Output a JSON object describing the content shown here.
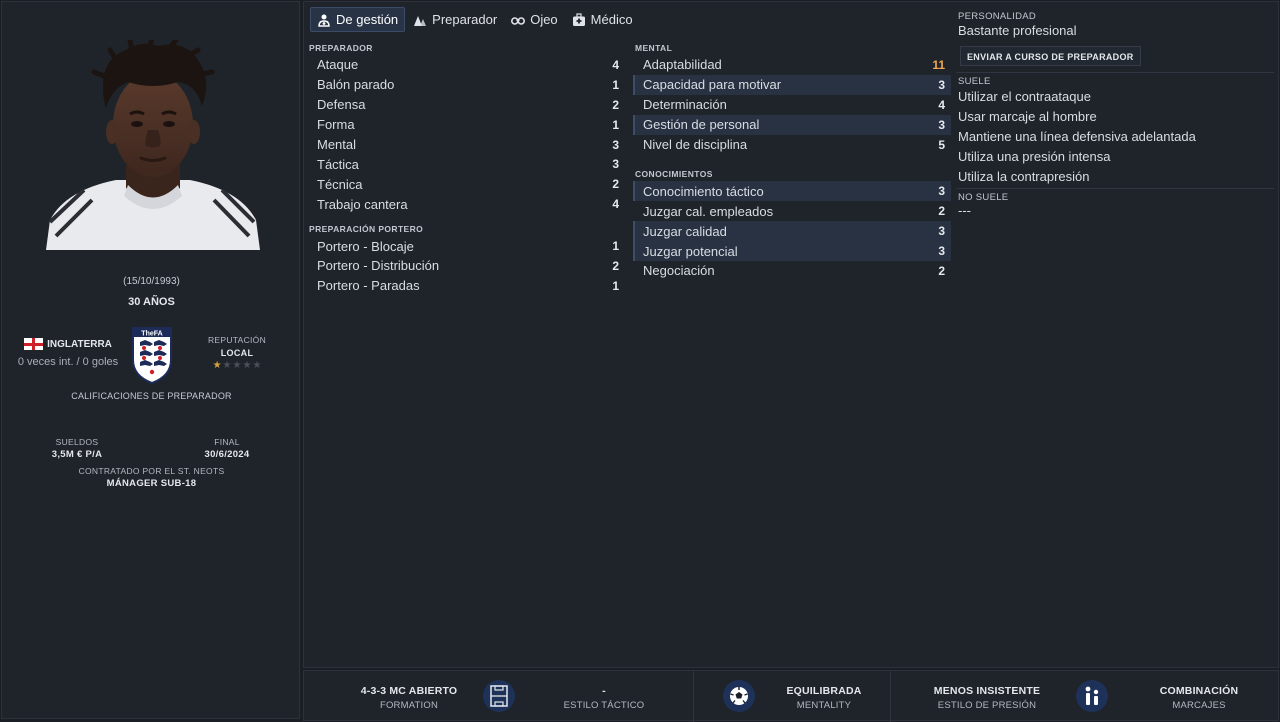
{
  "profile": {
    "dob": "(15/10/1993)",
    "age": "30 AÑOS",
    "nation": "INGLATERRA",
    "caps": "0 veces int. / 0 goles",
    "reputation_label": "REPUTACIÓN",
    "reputation_value": "LOCAL",
    "reputation_stars": 0.5,
    "crest_text": "TheFA",
    "coach_ratings_label": "CALIFICACIONES DE PREPARADOR",
    "wages_label": "SUELDOS",
    "wages_value": "3,5M € P/A",
    "final_label": "FINAL",
    "final_value": "30/6/2024",
    "hired_label": "CONTRATADO POR EL ST. NEOTS",
    "hired_value": "MÁNAGER SUB-18"
  },
  "tabs": [
    {
      "label": "De gestión",
      "icon": "people-icon",
      "active": true
    },
    {
      "label": "Preparador",
      "icon": "cones-icon",
      "active": false
    },
    {
      "label": "Ojeo",
      "icon": "binoculars-icon",
      "active": false
    },
    {
      "label": "Médico",
      "icon": "medical-kit-icon",
      "active": false
    }
  ],
  "coaching": {
    "title": "PREPARADOR",
    "rows": [
      {
        "label": "Ataque",
        "value": "4"
      },
      {
        "label": "Balón parado",
        "value": "1"
      },
      {
        "label": "Defensa",
        "value": "2"
      },
      {
        "label": "Forma",
        "value": "1"
      },
      {
        "label": "Mental",
        "value": "3"
      },
      {
        "label": "Táctica",
        "value": "3"
      },
      {
        "label": "Técnica",
        "value": "2"
      },
      {
        "label": "Trabajo cantera",
        "value": "4"
      }
    ]
  },
  "goalkeeping": {
    "title": "PREPARACIÓN PORTERO",
    "rows": [
      {
        "label": "Portero - Blocaje",
        "value": "1"
      },
      {
        "label": "Portero - Distribución",
        "value": "2"
      },
      {
        "label": "Portero - Paradas",
        "value": "1"
      }
    ]
  },
  "mental": {
    "title": "MENTAL",
    "rows": [
      {
        "label": "Adaptabilidad",
        "value": "11"
      },
      {
        "label": "Capacidad para motivar",
        "value": "3"
      },
      {
        "label": "Determinación",
        "value": "4"
      },
      {
        "label": "Gestión de personal",
        "value": "3"
      },
      {
        "label": "Nivel de disciplina",
        "value": "5"
      }
    ]
  },
  "knowledge": {
    "title": "CONOCIMIENTOS",
    "rows": [
      {
        "label": "Conocimiento táctico",
        "value": "3"
      },
      {
        "label": "Juzgar cal. empleados",
        "value": "2"
      },
      {
        "label": "Juzgar calidad",
        "value": "3"
      },
      {
        "label": "Juzgar potencial",
        "value": "3"
      },
      {
        "label": "Negociación",
        "value": "2"
      }
    ]
  },
  "personality": {
    "title": "PERSONALIDAD",
    "value": "Bastante profesional",
    "course_button": "ENVIAR A CURSO DE PREPARADOR"
  },
  "tendencies": {
    "usually_title": "SUELE",
    "usually": [
      "Utilizar el contraataque",
      "Usar marcaje al hombre",
      "Mantiene una línea defensiva adelantada",
      "Utiliza una presión intensa",
      "Utiliza la contrapresión"
    ],
    "never_title": "NO SUELE",
    "never": "---"
  },
  "tactics_bar": {
    "formation_value": "4-3-3 MC ABIERTO",
    "formation_label": "FORMATION",
    "style_value": "-",
    "style_label": "ESTILO TÁCTICO",
    "mentality_value": "EQUILIBRADA",
    "mentality_label": "MENTALITY",
    "pressing_value": "MENOS INSISTENTE",
    "pressing_label": "ESTILO DE PRESIÓN",
    "marking_value": "COMBINACIÓN",
    "marking_label": "MARCAJES"
  },
  "colors": {
    "accent": "#283446",
    "highlight_value": "#f2a651",
    "icon_circle": "#1e3158"
  }
}
